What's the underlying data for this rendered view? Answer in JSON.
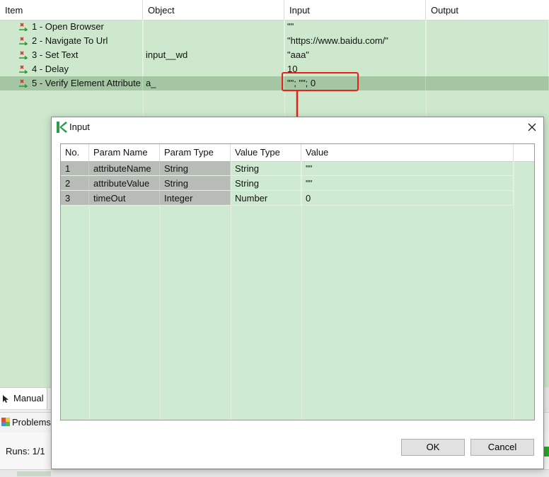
{
  "table": {
    "columns": [
      "Item",
      "Object",
      "Input",
      "Output"
    ],
    "rows": [
      {
        "item": "1 - Open Browser",
        "object": "",
        "input": "\"\"",
        "output": ""
      },
      {
        "item": "2 - Navigate To Url",
        "object": "",
        "input": "\"https://www.baidu.com/\"",
        "output": ""
      },
      {
        "item": "3 - Set Text",
        "object": "input__wd",
        "input": "\"aaa\"",
        "output": ""
      },
      {
        "item": "4 - Delay",
        "object": "",
        "input": "10",
        "output": ""
      },
      {
        "item": "5 - Verify Element Attribute",
        "object": "a_",
        "input": "\"\"; \"\"; 0",
        "output": ""
      }
    ]
  },
  "bottom": {
    "manual_tab": "Manual",
    "problems_tab": "Problems",
    "runs_label": "Runs: 1/1"
  },
  "dialog": {
    "title": "Input",
    "columns": [
      "No.",
      "Param Name",
      "Param Type",
      "Value Type",
      "Value"
    ],
    "rows": [
      {
        "no": "1",
        "param_name": "attributeName",
        "param_type": "String",
        "value_type": "String",
        "value": "\"\""
      },
      {
        "no": "2",
        "param_name": "attributeValue",
        "param_type": "String",
        "value_type": "String",
        "value": "\"\""
      },
      {
        "no": "3",
        "param_name": "timeOut",
        "param_type": "Integer",
        "value_type": "Number",
        "value": "0"
      }
    ],
    "ok_label": "OK",
    "cancel_label": "Cancel"
  },
  "colors": {
    "table_bg": "#cde8cc",
    "selected_row": "#a4c6a2",
    "highlight": "#e8201a",
    "readonly_cell": "#b7bcb7"
  }
}
